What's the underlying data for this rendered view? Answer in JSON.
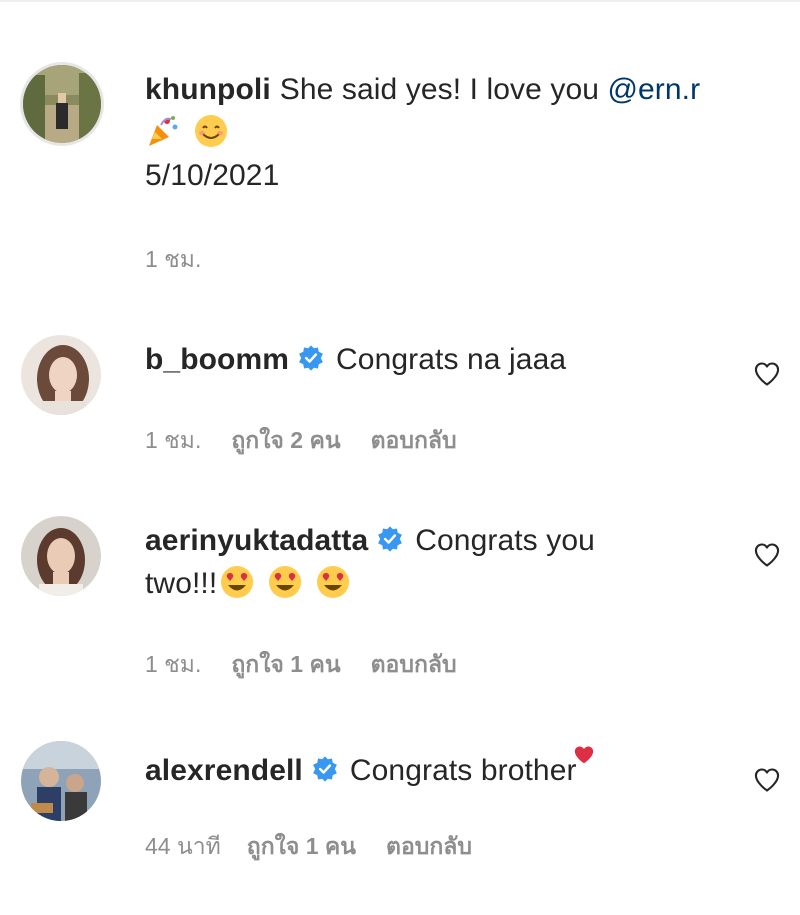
{
  "caption": {
    "username": "khunpoli",
    "text_before": "She said yes! I love you ",
    "mention": "@ern.r",
    "date": "5/10/2021",
    "time": "1 ชม."
  },
  "comments": [
    {
      "username": "b_boomm",
      "verified": true,
      "text": "Congrats na jaaa",
      "time": "1 ชม.",
      "likes": "ถูกใจ 2 คน",
      "reply": "ตอบกลับ"
    },
    {
      "username": "aerinyuktadatta",
      "verified": true,
      "text_line1": "Congrats you",
      "text_line2": "two!!!",
      "time": "1 ชม.",
      "likes": "ถูกใจ 1 คน",
      "reply": "ตอบกลับ"
    },
    {
      "username": "alexrendell",
      "verified": true,
      "text": "Congrats brother",
      "time": "44 นาที",
      "likes": "ถูกใจ 1 คน",
      "reply": "ตอบกลับ"
    }
  ],
  "colors": {
    "text": "#262626",
    "secondary": "#8e8e8e",
    "link": "#00376b",
    "verified": "#3897f0",
    "heart_emoji": "#e0245e"
  },
  "icons": [
    "verified-badge-icon",
    "heart-outline-icon",
    "party-popper-emoji",
    "smiling-emoji",
    "heart-eyes-emoji",
    "red-heart-emoji"
  ]
}
